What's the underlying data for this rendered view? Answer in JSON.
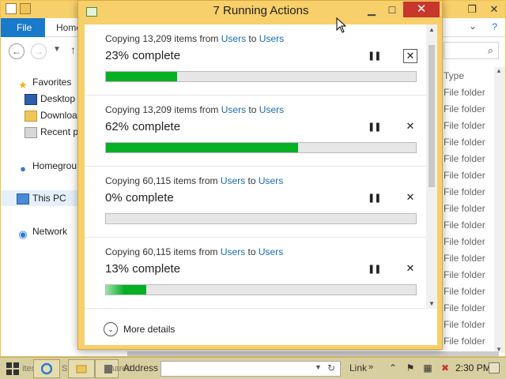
{
  "explorer": {
    "ribbon": {
      "file_tab": "File",
      "home_tab": "Home",
      "help": "?"
    },
    "nav": {
      "favorites": "Favorites",
      "desktop": "Desktop",
      "downloads": "Downloa",
      "recent": "Recent p",
      "homegroup": "Homegrou",
      "this_pc": "This PC",
      "network": "Network"
    },
    "type_column": {
      "header": "Type",
      "cells": [
        "File folder",
        "File folder",
        "File folder",
        "File folder",
        "File folder",
        "File folder",
        "File folder",
        "File folder",
        "File folder",
        "File folder",
        "File folder",
        "File folder",
        "File folder",
        "File folder",
        "File folder",
        "File folder"
      ]
    }
  },
  "dialog": {
    "title": "7 Running Actions",
    "operations": [
      {
        "prefix": "Copying 13,209 items from ",
        "from": "Users",
        "mid": " to ",
        "to": "Users",
        "percent_label": "23% complete",
        "progress": 0.23
      },
      {
        "prefix": "Copying 13,209 items from ",
        "from": "Users",
        "mid": " to ",
        "to": "Users",
        "percent_label": "62% complete",
        "progress": 0.62
      },
      {
        "prefix": "Copying 60,115 items from ",
        "from": "Users",
        "mid": " to ",
        "to": "Users",
        "percent_label": "0% complete",
        "progress": 0.0
      },
      {
        "prefix": "Copying 60,115 items from ",
        "from": "Users",
        "mid": " to ",
        "to": "Users",
        "percent_label": "13% complete",
        "progress": 0.13
      }
    ],
    "more_details": "More details",
    "colors": {
      "progress_fill": "#06b025",
      "title_bar": "#f7cf6b",
      "close_button": "#c7372c",
      "link": "#1a6bb0"
    }
  },
  "taskbar": {
    "ghost_left": "items",
    "ghost_mid": "Sta",
    "ghost_right": "Shared",
    "address_label": "Address",
    "link_label": "Link",
    "clock": "2:30 PM"
  }
}
